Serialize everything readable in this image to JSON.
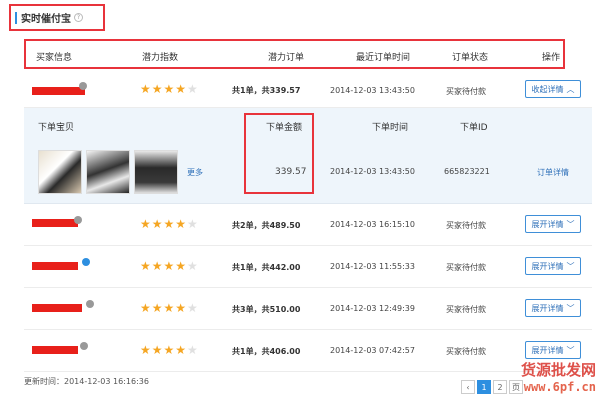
{
  "panel": {
    "title": "实时催付宝",
    "help_icon": "?"
  },
  "columns": {
    "buyer": "买家信息",
    "potential_index": "潜力指数",
    "potential_order": "潜力订单",
    "last_order_time": "最近订单时间",
    "order_status": "订单状态",
    "action": "操作"
  },
  "rows": [
    {
      "stars": 4,
      "order": "共1单，共339.57",
      "time": "2014-12-03 13:43:50",
      "status": "买家待付款",
      "button": "收起详情",
      "avatar_color": "#999999"
    },
    {
      "stars": 4,
      "order": "共2单，共489.50",
      "time": "2014-12-03 16:15:10",
      "status": "买家待付款",
      "button": "展开详情",
      "avatar_color": "#999999"
    },
    {
      "stars": 4,
      "order": "共1单，共442.00",
      "time": "2014-12-03 11:55:33",
      "status": "买家待付款",
      "button": "展开详情",
      "avatar_color": "#2d8fe0"
    },
    {
      "stars": 4,
      "order": "共3单，共510.00",
      "time": "2014-12-03 12:49:39",
      "status": "买家待付款",
      "button": "展开详情",
      "avatar_color": "#999999"
    },
    {
      "stars": 4,
      "order": "共1单，共406.00",
      "time": "2014-12-03 07:42:57",
      "status": "买家待付款",
      "button": "展开详情",
      "avatar_color": "#999999"
    }
  ],
  "detail": {
    "headers": {
      "item": "下单宝贝",
      "amount": "下单金额",
      "time": "下单时间",
      "order_id": "下单ID"
    },
    "more_label": "更多",
    "amount": "339.57",
    "time": "2014-12-03 13:43:50",
    "order_id": "665823221",
    "link": "订单详情"
  },
  "footer": {
    "update_time": "更新时间：2014-12-03 16:16:36"
  },
  "pager": {
    "prev": "‹",
    "current": "1",
    "next": "2",
    "last": "页"
  },
  "watermark": {
    "line1": "货源批发网",
    "line2": "www.6pf.cn"
  },
  "colors": {
    "accent": "#2d8fe0",
    "highlight_box": "#e8333b",
    "star": "#f5a623",
    "redaction": "#e8201a"
  }
}
